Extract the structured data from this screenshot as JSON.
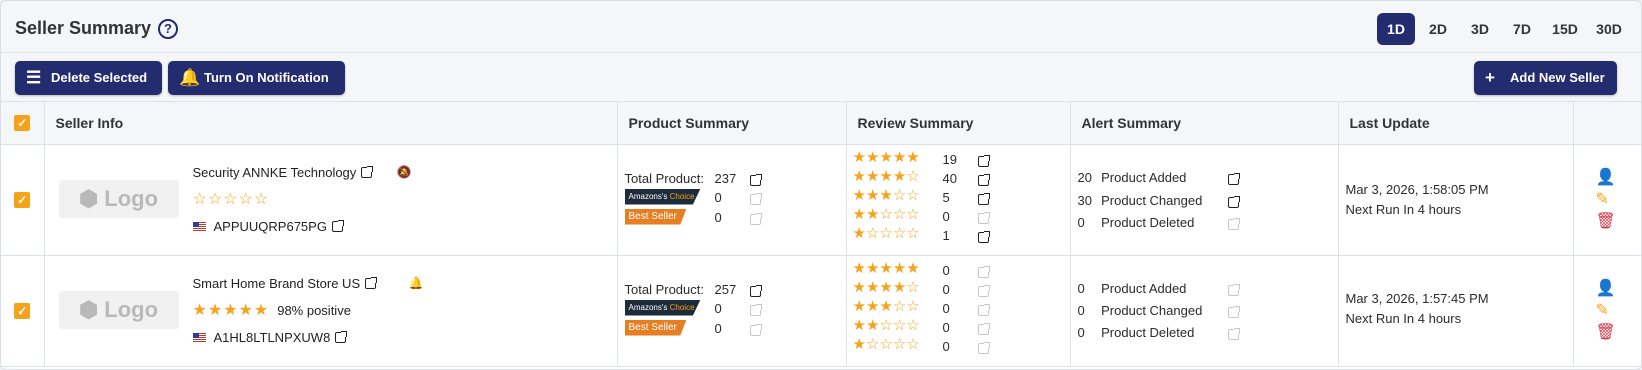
{
  "header": {
    "title": "Seller Summary",
    "help_icon": "question-circle-icon"
  },
  "ranges": [
    {
      "label": "1D",
      "active": true
    },
    {
      "label": "2D",
      "active": false
    },
    {
      "label": "3D",
      "active": false
    },
    {
      "label": "7D",
      "active": false
    },
    {
      "label": "15D",
      "active": false
    },
    {
      "label": "30D",
      "active": false
    }
  ],
  "toolbar": {
    "delete_label": "Delete Selected",
    "notify_label": "Turn On Notification",
    "add_label": "Add New Seller"
  },
  "columns": {
    "seller_info": "Seller Info",
    "product_summary": "Product Summary",
    "review_summary": "Review Summary",
    "alert_summary": "Alert Summary",
    "last_update": "Last Update"
  },
  "labels": {
    "logo": "Logo",
    "total_product": "Total Product:",
    "amazons": "Amazons's",
    "choice": "Choice",
    "best_seller": "Best Seller",
    "product_added": "Product Added",
    "product_changed": "Product Changed",
    "product_deleted": "Product Deleted"
  },
  "colors": {
    "primary": "#222c6e",
    "accent": "#f6a31b",
    "danger": "#d63447"
  },
  "rows": [
    {
      "checked": true,
      "name": "Security ANNKE Technology",
      "notification": "off",
      "rating_stars": 0,
      "rating_text": "",
      "seller_id": "APPUUQRP675PG",
      "total_product": "237",
      "amazons_choice": "0",
      "best_seller": "0",
      "reviews": [
        {
          "stars": 5,
          "count": "19"
        },
        {
          "stars": 4,
          "count": "40"
        },
        {
          "stars": 3,
          "count": "5"
        },
        {
          "stars": 2,
          "count": "0"
        },
        {
          "stars": 1,
          "count": "1"
        }
      ],
      "alerts": {
        "added": "20",
        "changed": "30",
        "deleted": "0"
      },
      "last_update": "Mar 3, 2026, 1:58:05 PM",
      "next_run": "Next Run In 4 hours"
    },
    {
      "checked": true,
      "name": "Smart Home Brand Store US",
      "notification": "on",
      "rating_stars": 5,
      "rating_text": "98% positive",
      "seller_id": "A1HL8LTLNPXUW8",
      "total_product": "257",
      "amazons_choice": "0",
      "best_seller": "0",
      "reviews": [
        {
          "stars": 5,
          "count": "0"
        },
        {
          "stars": 4,
          "count": "0"
        },
        {
          "stars": 3,
          "count": "0"
        },
        {
          "stars": 2,
          "count": "0"
        },
        {
          "stars": 1,
          "count": "0"
        }
      ],
      "alerts": {
        "added": "0",
        "changed": "0",
        "deleted": "0"
      },
      "last_update": "Mar 3, 2026, 1:57:45 PM",
      "next_run": "Next Run In 4 hours"
    }
  ]
}
